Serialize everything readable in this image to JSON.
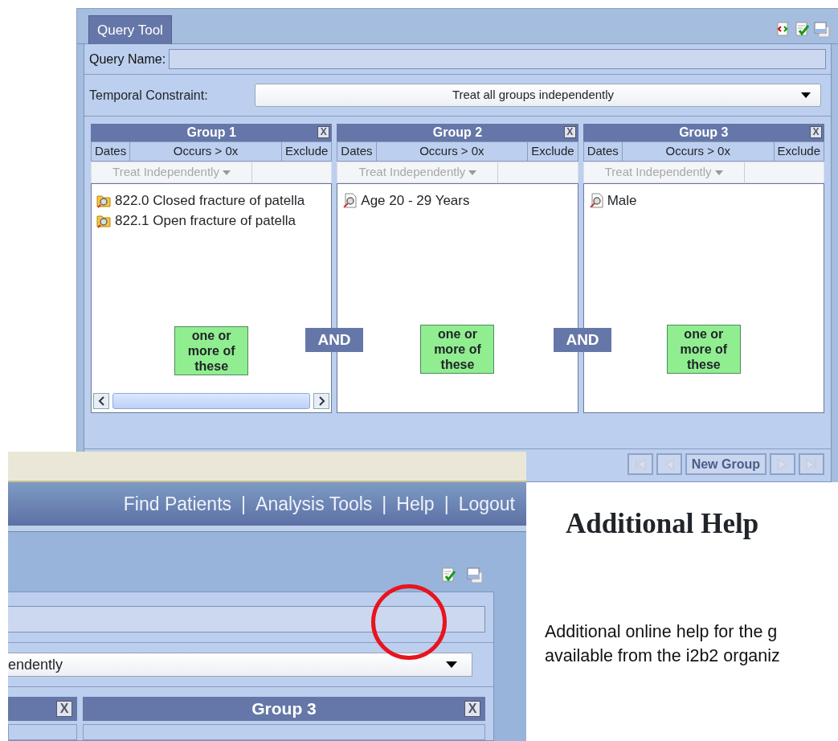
{
  "query_tool_window": {
    "tab": {
      "label": "Query Tool",
      "selected": true
    },
    "query_name_label": "Query Name:",
    "temporal_constraint": {
      "label": "Temporal Constraint:",
      "value": "Treat all groups independently"
    },
    "groups": [
      {
        "title": "Group 1",
        "close_label": "X",
        "columns": [
          "Dates",
          "Occurs > 0x",
          "Exclude"
        ],
        "timing": {
          "label": "Treat Independently",
          "disabled": true
        },
        "items": [
          {
            "kind": "folder",
            "label": "822.0 Closed fracture of patella"
          },
          {
            "kind": "folder",
            "label": "822.1 Open fracture of patella"
          }
        ],
        "hint": "one or more of these",
        "scrollbar": true
      },
      {
        "title": "Group 2",
        "close_label": "X",
        "columns": [
          "Dates",
          "Occurs > 0x",
          "Exclude"
        ],
        "timing": {
          "label": "Treat Independently",
          "disabled": true
        },
        "items": [
          {
            "kind": "leaf",
            "label": "Age 20 - 29 Years"
          }
        ],
        "hint": "one or more of these",
        "scrollbar": false
      },
      {
        "title": "Group 3",
        "close_label": "X",
        "columns": [
          "Dates",
          "Occurs > 0x",
          "Exclude"
        ],
        "timing": {
          "label": "Treat Independently",
          "disabled": true
        },
        "items": [
          {
            "kind": "leaf",
            "label": "Male"
          }
        ],
        "hint": "one or more of these",
        "scrollbar": false
      }
    ],
    "connectors": [
      "AND",
      "AND"
    ],
    "group_nav": {
      "label": "New Group"
    }
  },
  "find_patients_window": {
    "nav_links": [
      "Find Patients",
      "Analysis Tools",
      "Help",
      "Logout"
    ],
    "separator": "|",
    "temporal_value": "endently",
    "group_close_labels": [
      "X",
      "X"
    ],
    "group_title": "Group 3"
  },
  "document": {
    "heading": "Additional Help",
    "lines": [
      "Additional online help for the g",
      "available from the i2b2 organiz"
    ]
  }
}
